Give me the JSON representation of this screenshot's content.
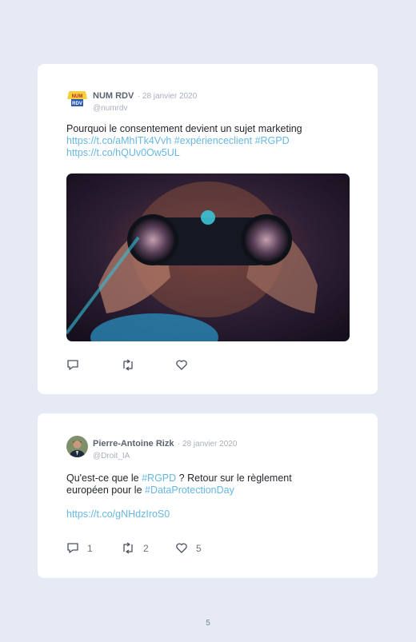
{
  "page_number": "5",
  "tweets": [
    {
      "author": "NUM RDV",
      "date": "· 28 janvier 2020",
      "handle": "@numrdv",
      "avatar_icon": "numrdv-logo",
      "text_line1": "Pourquoi le consentement devient un sujet marketing",
      "link1": "https://t.co/aMhITk4Vvh",
      "tag1": "#expérienceclient",
      "tag2": "#RGPD",
      "link2": "https://t.co/hQUv0Ow5UL",
      "media": "person-with-binoculars-photo",
      "replies": "",
      "retweets": "",
      "likes": ""
    },
    {
      "author": "Pierre-Antoine Rizk",
      "date": "· 28 janvier 2020",
      "handle": "@Droit_IA",
      "avatar_icon": "profile-photo",
      "text_part1": "Qu'est-ce que le ",
      "tag1": "#RGPD",
      "text_part2": " ? Retour sur le règlement",
      "text_part3": "européen pour le ",
      "tag2": "#DataProtectionDay",
      "link1": "https://t.co/gNHdzIroS0",
      "replies": "1",
      "retweets": "2",
      "likes": "5"
    }
  ],
  "colors": {
    "background": "#e6eaf4",
    "card": "#ffffff",
    "link": "#67b7e1",
    "name": "#5b6270",
    "muted": "#a9afba"
  }
}
